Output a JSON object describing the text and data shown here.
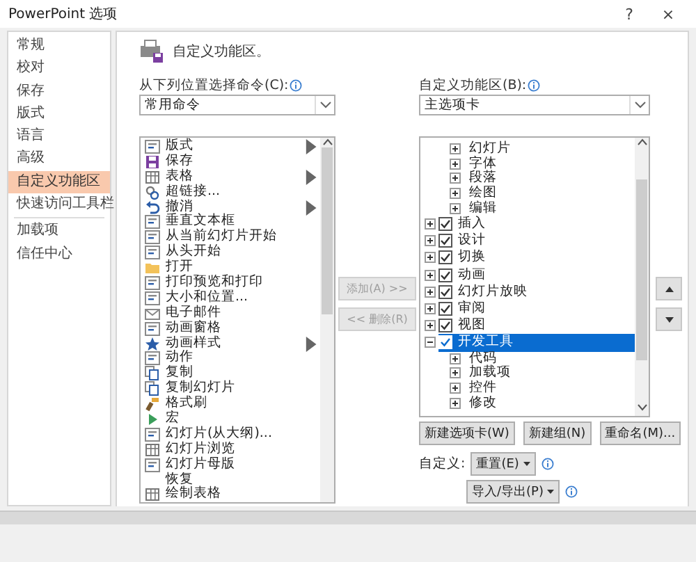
{
  "window": {
    "title": "PowerPoint 选项",
    "help": "?",
    "close": "×"
  },
  "sidebar": {
    "items": [
      {
        "label": "常规",
        "selected": false,
        "separator_before": false
      },
      {
        "label": "校对",
        "selected": false,
        "separator_before": false
      },
      {
        "label": "保存",
        "selected": false,
        "separator_before": false
      },
      {
        "label": "版式",
        "selected": false,
        "separator_before": false
      },
      {
        "label": "语言",
        "selected": false,
        "separator_before": false
      },
      {
        "label": "高级",
        "selected": false,
        "separator_before": false
      },
      {
        "label": "自定义功能区",
        "selected": true,
        "separator_before": false
      },
      {
        "label": "快速访问工具栏",
        "selected": false,
        "separator_before": false
      },
      {
        "label": "加载项",
        "selected": false,
        "separator_before": true
      },
      {
        "label": "信任中心",
        "selected": false,
        "separator_before": false
      }
    ]
  },
  "main": {
    "heading": "自定义功能区。",
    "source_label": "从下列位置选择命令(C):",
    "source_value": "常用命令",
    "target_label": "自定义功能区(B):",
    "target_value": "主选项卡",
    "commands": [
      {
        "label": "版式",
        "submenu": true
      },
      {
        "label": "保存",
        "submenu": false
      },
      {
        "label": "表格",
        "submenu": true
      },
      {
        "label": "超链接...",
        "submenu": false
      },
      {
        "label": "撤消",
        "submenu": true
      },
      {
        "label": "垂直文本框",
        "submenu": false
      },
      {
        "label": "从当前幻灯片开始",
        "submenu": false
      },
      {
        "label": "从头开始",
        "submenu": false
      },
      {
        "label": "打开",
        "submenu": false
      },
      {
        "label": "打印预览和打印",
        "submenu": false
      },
      {
        "label": "大小和位置...",
        "submenu": false
      },
      {
        "label": "电子邮件",
        "submenu": false
      },
      {
        "label": "动画窗格",
        "submenu": false
      },
      {
        "label": "动画样式",
        "submenu": true
      },
      {
        "label": "动作",
        "submenu": false
      },
      {
        "label": "复制",
        "submenu": false
      },
      {
        "label": "复制幻灯片",
        "submenu": false
      },
      {
        "label": "格式刷",
        "submenu": false
      },
      {
        "label": "宏",
        "submenu": false
      },
      {
        "label": "幻灯片(从大纲)...",
        "submenu": false
      },
      {
        "label": "幻灯片浏览",
        "submenu": false
      },
      {
        "label": "幻灯片母版",
        "submenu": false
      },
      {
        "label": "恢复",
        "submenu": false
      },
      {
        "label": "绘制表格",
        "submenu": false
      }
    ],
    "add_button": {
      "label": "添加(A) >>",
      "disabled": true
    },
    "remove_button": {
      "label": "<< 删除(R)",
      "disabled": true
    },
    "tree": [
      {
        "children": [
          {
            "label": "幻灯片",
            "expanded": false
          },
          {
            "label": "字体",
            "expanded": false
          },
          {
            "label": "段落",
            "expanded": false
          },
          {
            "label": "绘图",
            "expanded": false
          },
          {
            "label": "编辑",
            "expanded": false
          }
        ]
      },
      {
        "label": "插入",
        "checked": true,
        "expanded": false,
        "selected": false
      },
      {
        "label": "设计",
        "checked": true,
        "expanded": false,
        "selected": false
      },
      {
        "label": "切换",
        "checked": true,
        "expanded": false,
        "selected": false
      },
      {
        "label": "动画",
        "checked": true,
        "expanded": false,
        "selected": false
      },
      {
        "label": "幻灯片放映",
        "checked": true,
        "expanded": false,
        "selected": false
      },
      {
        "label": "审阅",
        "checked": true,
        "expanded": false,
        "selected": false
      },
      {
        "label": "视图",
        "checked": true,
        "expanded": false,
        "selected": false
      },
      {
        "label": "开发工具",
        "checked": true,
        "expanded": true,
        "selected": true,
        "children": [
          {
            "label": "代码",
            "expanded": false
          },
          {
            "label": "加载项",
            "expanded": false
          },
          {
            "label": "控件",
            "expanded": false
          },
          {
            "label": "修改",
            "expanded": false
          }
        ]
      }
    ],
    "new_tab_button": "新建选项卡(W)",
    "new_group_button": "新建组(N)",
    "rename_button": "重命名(M)...",
    "customize_label": "自定义:",
    "reset_button": "重置(E)",
    "import_export_button": "导入/导出(P)"
  }
}
